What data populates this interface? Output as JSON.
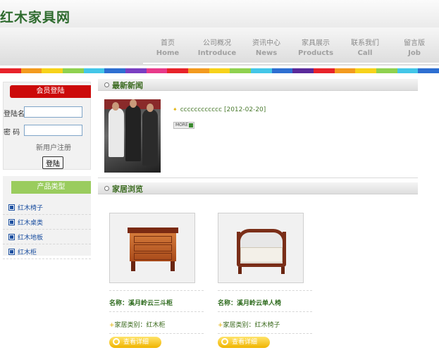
{
  "site": {
    "title": "红木家具网"
  },
  "nav": [
    {
      "cn": "首页",
      "en": "Home"
    },
    {
      "cn": "公司概况",
      "en": "Introduce"
    },
    {
      "cn": "资讯中心",
      "en": "News"
    },
    {
      "cn": "家具展示",
      "en": "Products"
    },
    {
      "cn": "联系我们",
      "en": "Call"
    },
    {
      "cn": "留言版",
      "en": "Job"
    }
  ],
  "rainbow_colors": [
    "#e8232a",
    "#f39a1e",
    "#f7d21a",
    "#8fd14f",
    "#43c6e8",
    "#2e6fd1",
    "#7a3fc2",
    "#e83a8a",
    "#e8232a",
    "#f39a1e",
    "#f7d21a",
    "#8fd14f",
    "#43c6e8",
    "#2e6fd1",
    "#5a2a9a",
    "#e8232a",
    "#f39a1e",
    "#f7d21a",
    "#8fd14f",
    "#43c6e8",
    "#2e6fd1"
  ],
  "login": {
    "header": "会员登陆",
    "username_label": "登陆名",
    "username_value": "",
    "password_label": "密  码",
    "password_value": "",
    "register_link": "新用户注册",
    "login_button": "登陆"
  },
  "categories": {
    "header": "产品类型",
    "items": [
      "红木椅子",
      "红木桌类",
      "红木地板",
      "红木柜"
    ]
  },
  "news": {
    "section_title": "最新新闻",
    "items": [
      {
        "title": "cccccccccccc",
        "date": "[2012-02-20]"
      }
    ],
    "more_label": "MORE"
  },
  "products": {
    "section_title": "家居浏览",
    "items": [
      {
        "name": "名称：溪月岭云三斗柜",
        "category": "家居类别：红木柜",
        "button": "查看详细"
      },
      {
        "name": "名称：溪月岭云单人椅",
        "category": "家居类别：红木椅子",
        "button": "查看详细"
      }
    ]
  }
}
